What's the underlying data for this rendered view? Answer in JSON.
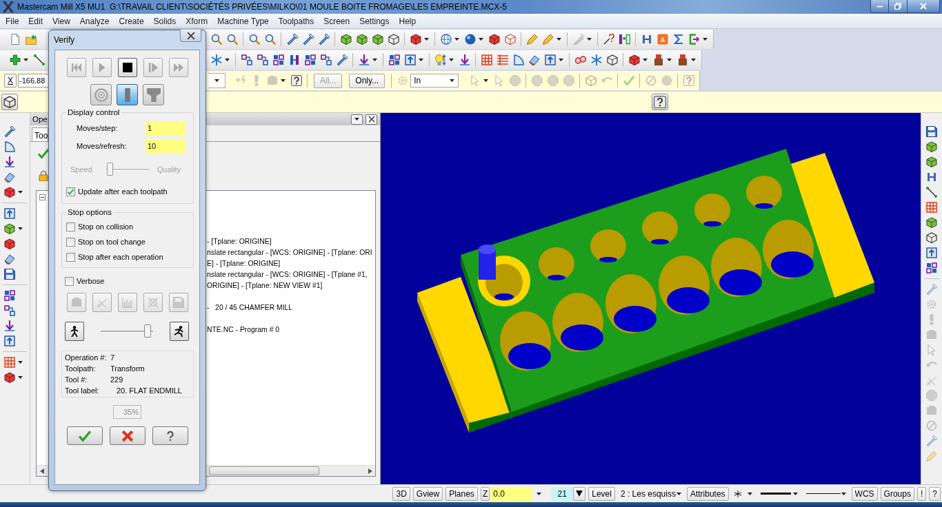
{
  "window": {
    "title": "Mastercam Mill X5 MU1  G:\\TRAVAIL CLIENT\\SOCIÉTÉS PRIVÉES\\MILKO\\01 MOULE BOITE FROMAGE\\LES EMPREINTE.MCX-5"
  },
  "menu": [
    "File",
    "Edit",
    "View",
    "Analyze",
    "Create",
    "Solids",
    "Xform",
    "Machine Type",
    "Toolpaths",
    "Screen",
    "Settings",
    "Help"
  ],
  "ribbon": {
    "coordinate_label": "X",
    "coordinate_value": "-166.88",
    "select_buttons": [
      {
        "label": "All...",
        "disabled": true
      },
      {
        "label": "Only...",
        "disabled": false
      }
    ],
    "mode": "In"
  },
  "operations_panel": {
    "title": "Ope",
    "tab": "Too",
    "lines": [
      "- [Tplane: ORIGINE]",
      "nslate rectangular - [WCS: ORIGINE] - [Tplane: ORI",
      "E] - [Tplane: ORIGINE]",
      "nslate rectangular - [WCS: ORIGINE] - [Tplane #1,",
      "ORIGINE] - [Tplane: NEW VIEW #1]",
      "-   20 / 45 CHAMFER MILL",
      "NTE.NC - Program # 0"
    ]
  },
  "verify_dialog": {
    "title": "Verify",
    "transport": [
      {
        "disabled": true
      },
      {
        "disabled": true
      },
      {
        "disabled": false
      },
      {
        "disabled": true
      },
      {
        "disabled": true
      }
    ],
    "display_modes": [
      {
        "selected": false
      },
      {
        "selected": true
      },
      {
        "selected": false
      }
    ],
    "display_control": {
      "heading": "Display control",
      "fields": [
        {
          "label": "Moves/step:",
          "value": "1"
        },
        {
          "label": "Moves/refresh:",
          "value": "10"
        }
      ],
      "quality_slider": {
        "start_label": "Speed",
        "end_label": "Quality",
        "level": 0.03,
        "disabled": true
      },
      "update_option": {
        "label": "Update after each toolpath",
        "checked": true
      }
    },
    "stop_options": {
      "heading": "Stop options",
      "options": [
        {
          "label": "Stop on collision",
          "checked": false
        },
        {
          "label": "Stop on tool change",
          "checked": false
        },
        {
          "label": "Stop after each operation",
          "checked": false
        }
      ]
    },
    "verbose": {
      "label": "Verbose",
      "checked": false
    },
    "output_buttons": [
      {
        "disabled": true
      },
      {
        "disabled": true
      },
      {
        "disabled": true
      },
      {
        "disabled": true
      },
      {
        "disabled": true
      }
    ],
    "speed_slider": {
      "level": 0.95
    },
    "info": [
      {
        "label": "Operation #:",
        "value": "7"
      },
      {
        "label": "Toolpath:",
        "value": "Transform"
      },
      {
        "label": "Tool #:",
        "value": "229"
      },
      {
        "label": "Tool label:",
        "value": "20. FLAT ENDMILL"
      }
    ],
    "progress": "35%"
  },
  "status_bar": {
    "view_buttons": [
      "3D",
      "Gview",
      "Planes"
    ],
    "z_label": "Z",
    "z_value": "0.0",
    "color_value": "21",
    "level_label": "Level",
    "level_value": "2 : Les esquiss",
    "attributes_label": "Attributes",
    "right_buttons": [
      "WCS",
      "Groups",
      "!",
      "?"
    ]
  }
}
